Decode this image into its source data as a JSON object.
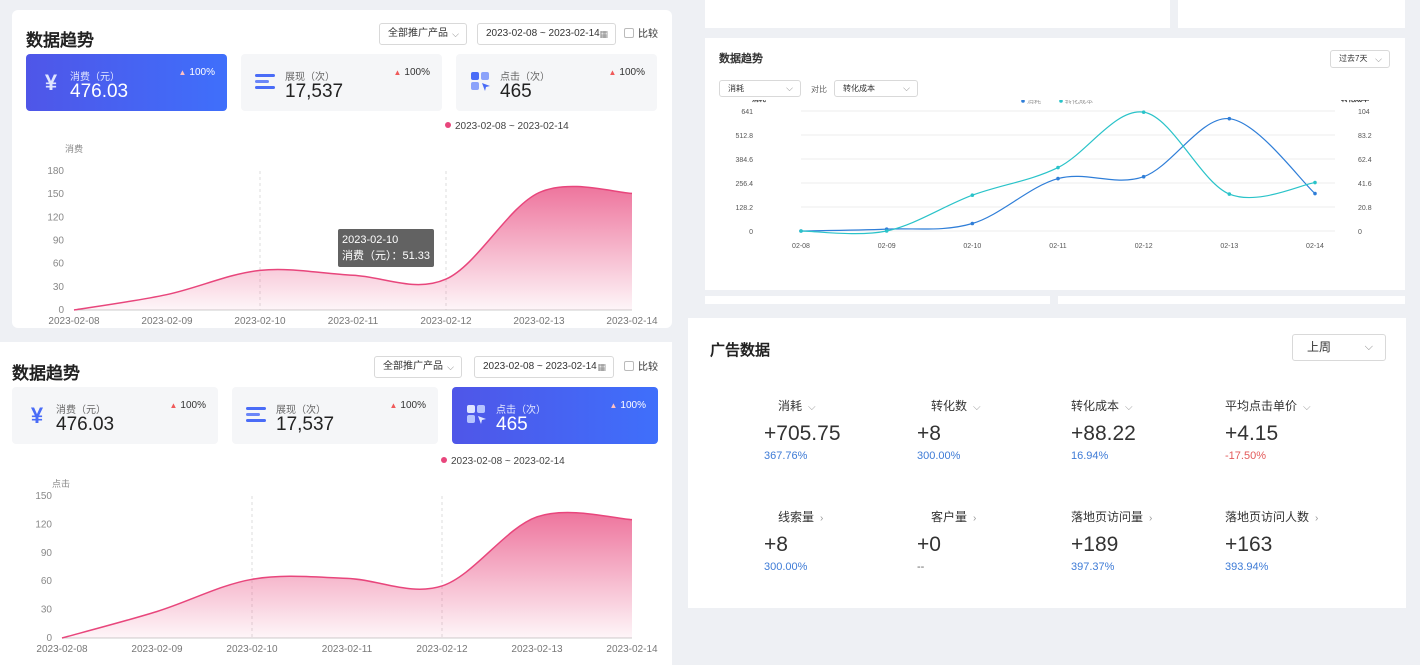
{
  "panel1": {
    "title": "数据趋势",
    "product_select": "全部推广产品",
    "date_range": "2023-02-08 ~ 2023-02-14",
    "compare": "比较",
    "cards": [
      {
        "label": "消费（元）",
        "value": "476.03",
        "pct": "100%",
        "icon": "yuan-icon"
      },
      {
        "label": "展现（次）",
        "value": "17,537",
        "pct": "100%",
        "icon": "bars-icon"
      },
      {
        "label": "点击（次）",
        "value": "465",
        "pct": "100%",
        "icon": "click-icon"
      }
    ],
    "legend": "2023-02-08 ~ 2023-02-14",
    "tooltip_date": "2023-02-10",
    "tooltip_value": "消费（元）：51.33"
  },
  "panel2": {
    "title": "数据趋势",
    "product_select": "全部推广产品",
    "date_range": "2023-02-08 ~ 2023-02-14",
    "compare": "比较",
    "cards": [
      {
        "label": "消费（元）",
        "value": "476.03",
        "pct": "100%",
        "icon": "yuan-icon"
      },
      {
        "label": "展现（次）",
        "value": "17,537",
        "pct": "100%",
        "icon": "bars-icon"
      },
      {
        "label": "点击（次）",
        "value": "465",
        "pct": "100%",
        "icon": "click-icon"
      }
    ],
    "legend": "2023-02-08 ~ 2023-02-14"
  },
  "panel3": {
    "title": "数据趋势",
    "range_select": "过去7天",
    "metric_select": "消耗",
    "compare_label": "对比",
    "compare_select": "转化成本",
    "left_axis_label": "消耗",
    "right_axis_label": "转化成本",
    "legend": [
      "消耗",
      "转化成本"
    ]
  },
  "panel4": {
    "title": "广告数据",
    "period_select": "上周",
    "metrics": [
      {
        "label": "消耗",
        "value": "+705.75",
        "pct": "367.76%",
        "arrow": "chevron-down",
        "tone": "pos"
      },
      {
        "label": "转化数",
        "value": "+8",
        "pct": "300.00%",
        "arrow": "chevron-down",
        "tone": "pos"
      },
      {
        "label": "转化成本",
        "value": "+88.22",
        "pct": "16.94%",
        "arrow": "chevron-down",
        "tone": "pos"
      },
      {
        "label": "平均点击单价",
        "value": "+4.15",
        "pct": "-17.50%",
        "arrow": "chevron-down",
        "tone": "neg"
      },
      {
        "label": "线索量",
        "value": "+8",
        "pct": "300.00%",
        "arrow": "chevron-right",
        "tone": "pos"
      },
      {
        "label": "客户量",
        "value": "+0",
        "pct": "--",
        "arrow": "chevron-right",
        "tone": "none"
      },
      {
        "label": "落地页访问量",
        "value": "+189",
        "pct": "397.37%",
        "arrow": "chevron-right",
        "tone": "pos"
      },
      {
        "label": "落地页访问人数",
        "value": "+163",
        "pct": "393.94%",
        "arrow": "chevron-right",
        "tone": "pos"
      }
    ]
  },
  "chart_data": [
    {
      "type": "area",
      "ylabel": "消费",
      "x": [
        "2023-02-08",
        "2023-02-09",
        "2023-02-10",
        "2023-02-11",
        "2023-02-12",
        "2023-02-13",
        "2023-02-14"
      ],
      "series": [
        {
          "values": [
            0,
            20,
            51.33,
            45,
            40,
            152,
            151
          ]
        }
      ],
      "yticks": [
        0,
        30,
        60,
        90,
        120,
        150,
        180
      ],
      "ylim": [
        0,
        180
      ],
      "color": "#e8467c",
      "grid": true
    },
    {
      "type": "area",
      "ylabel": "点击",
      "x": [
        "2023-02-08",
        "2023-02-09",
        "2023-02-10",
        "2023-02-11",
        "2023-02-12",
        "2023-02-13",
        "2023-02-14"
      ],
      "series": [
        {
          "values": [
            0,
            28,
            62,
            63,
            55,
            128,
            125
          ]
        }
      ],
      "yticks": [
        0,
        30,
        60,
        90,
        120,
        150
      ],
      "ylim": [
        0,
        150
      ],
      "color": "#e8467c",
      "grid": true
    },
    {
      "type": "line",
      "x": [
        "02-08",
        "02-09",
        "02-10",
        "02-11",
        "02-12",
        "02-13",
        "02-14"
      ],
      "series": [
        {
          "name": "消耗",
          "axis": "left",
          "color": "#2f7ed8",
          "values": [
            0,
            10,
            40,
            280,
            290,
            600,
            200
          ]
        },
        {
          "name": "转化成本",
          "axis": "right",
          "color": "#2ac3c9",
          "values": [
            0,
            0,
            31,
            55,
            103,
            32,
            42
          ]
        }
      ],
      "left_ticks": [
        "0",
        "128.2",
        "256.4",
        "384.6",
        "512.8",
        "641"
      ],
      "left_lim": [
        0,
        641
      ],
      "right_ticks": [
        "0",
        "20.8",
        "41.6",
        "62.4",
        "83.2",
        "104"
      ],
      "right_lim": [
        0,
        104
      ],
      "left_label": "消耗",
      "right_label": "转化成本"
    }
  ]
}
